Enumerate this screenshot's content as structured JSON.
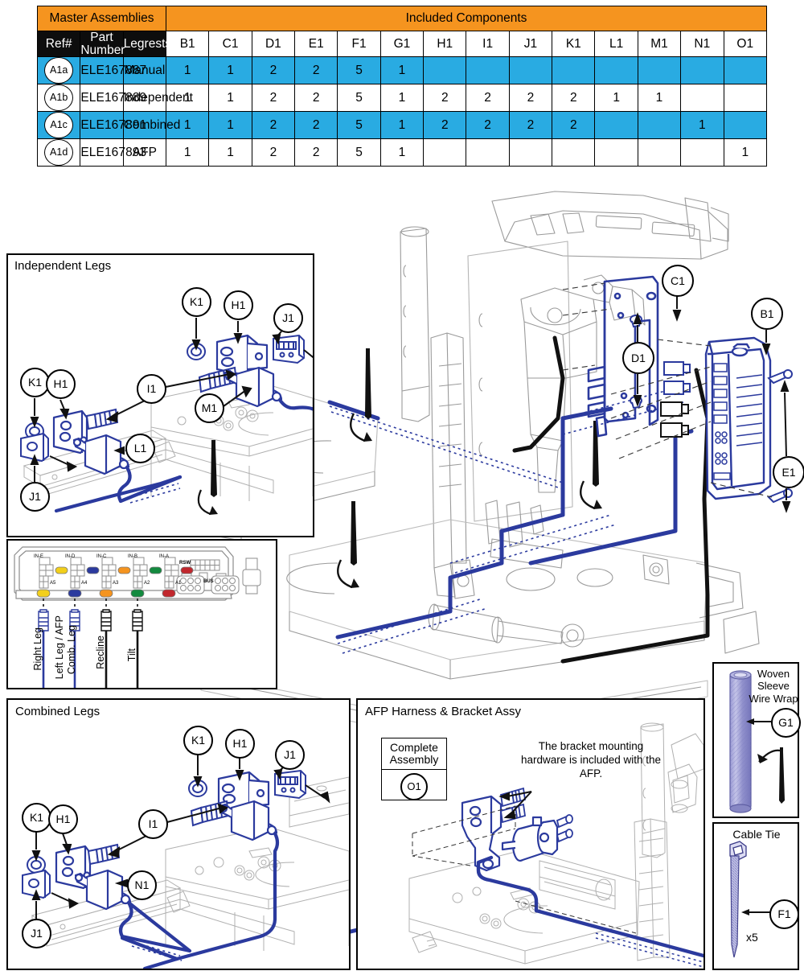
{
  "table": {
    "group_headers": [
      {
        "label": "Master Assemblies",
        "span": 3
      },
      {
        "label": "Included Components",
        "span": 14
      }
    ],
    "columns": [
      "Ref#",
      "Part Number",
      "Legrests"
    ],
    "component_columns": [
      "B1",
      "C1",
      "D1",
      "E1",
      "F1",
      "G1",
      "H1",
      "I1",
      "J1",
      "K1",
      "L1",
      "M1",
      "N1",
      "O1"
    ],
    "rows": [
      {
        "ref": "A1a",
        "part_number": "ELE167887",
        "legrests": "Manual",
        "qty": [
          "1",
          "1",
          "2",
          "2",
          "5",
          "1",
          "",
          "",
          "",
          "",
          "",
          "",
          "",
          ""
        ],
        "highlight": true
      },
      {
        "ref": "A1b",
        "part_number": "ELE167889",
        "legrests": "Independent",
        "qty": [
          "1",
          "1",
          "2",
          "2",
          "5",
          "1",
          "2",
          "2",
          "2",
          "2",
          "1",
          "1",
          "",
          ""
        ],
        "highlight": false
      },
      {
        "ref": "A1c",
        "part_number": "ELE167891",
        "legrests": "Combined",
        "qty": [
          "1",
          "1",
          "2",
          "2",
          "5",
          "1",
          "2",
          "2",
          "2",
          "2",
          "",
          "",
          "1",
          ""
        ],
        "highlight": true
      },
      {
        "ref": "A1d",
        "part_number": "ELE167893",
        "legrests": "AFP",
        "qty": [
          "1",
          "1",
          "2",
          "2",
          "5",
          "1",
          "",
          "",
          "",
          "",
          "",
          "",
          "",
          "1"
        ],
        "highlight": false
      }
    ]
  },
  "colors": {
    "orange": "#F5941F",
    "table_blue": "#29ABE2",
    "navy": "#2B3A9E",
    "header_black": "#0D0D0D",
    "sleeve_purple": "#8A8AC8",
    "line_grey": "#9a9a9a"
  },
  "panels": {
    "independent": {
      "title": "Independent Legs",
      "callouts": [
        "K1",
        "H1",
        "J1",
        "I1",
        "M1",
        "K1",
        "H1",
        "L1",
        "J1"
      ]
    },
    "combined": {
      "title": "Combined Legs",
      "callouts": [
        "K1",
        "H1",
        "J1",
        "I1",
        "N1",
        "K1",
        "H1",
        "J1"
      ]
    },
    "afp": {
      "title": "AFP Harness & Bracket Assy",
      "complete_assembly_label_1": "Complete",
      "complete_assembly_label_2": "Assembly",
      "complete_assembly_ref": "O1",
      "note": "The bracket mounting hardware is included with the AFP."
    },
    "sleeve": {
      "title_1": "Woven",
      "title_2": "Sleeve",
      "title_3": "Wire Wrap",
      "ref": "G1"
    },
    "cable_tie": {
      "title": "Cable Tie",
      "ref": "F1",
      "quantity": "x5"
    },
    "connector": {
      "port_labels_top": [
        "IN-E",
        "IN-D",
        "IN-C",
        "IN-B",
        "IN-A"
      ],
      "port_labels_bottom": [
        "A5",
        "A4",
        "A3",
        "A2",
        "A1"
      ],
      "extra_labels": [
        "RSW",
        "BUS"
      ],
      "cable_labels": [
        "Right Leg",
        "Left Leg / AFP",
        "Comb. Leg",
        "Recline",
        "Tilt"
      ],
      "led_colors": [
        "#F2CF1B",
        "#2B3A9E",
        "#F5941F",
        "#138A3F",
        "#C1272D"
      ]
    }
  },
  "main_callouts": [
    {
      "ref": "C1"
    },
    {
      "ref": "B1"
    },
    {
      "ref": "D1"
    },
    {
      "ref": "E1"
    }
  ]
}
